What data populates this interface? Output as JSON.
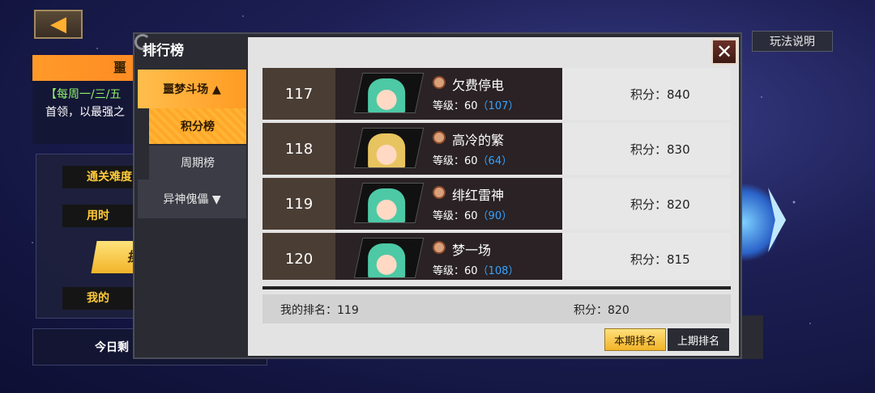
{
  "header": {
    "back_icon": "back-arrow-icon",
    "rules_label": "玩法说明"
  },
  "background": {
    "header_label": "噩",
    "desc_line1": "【每周一/三/五",
    "desc_line2": "首领，以最强之",
    "label_difficulty": "通关难度",
    "label_time": "用时",
    "label_mine": "我的",
    "button_short": "挑",
    "today_remaining": "今日剩"
  },
  "modal": {
    "title": "排行榜",
    "close_icon": "close-x-icon",
    "sidebar": {
      "main_active": "噩梦斗场 ▲",
      "sub_active": "积分榜",
      "sub_inactive": "周期榜",
      "main_inactive": "异神傀儡 ▼"
    },
    "rows": [
      {
        "rank": "117",
        "name": "欠费停电",
        "level_text": "等级：60",
        "level_paren": "（107）",
        "score": "积分：840",
        "avatar": "green"
      },
      {
        "rank": "118",
        "name": "高冷的繁",
        "level_text": "等级：60",
        "level_paren": "（64）",
        "score": "积分：830",
        "avatar": "blond"
      },
      {
        "rank": "119",
        "name": "绯红雷神",
        "level_text": "等级：60",
        "level_paren": "（90）",
        "score": "积分：820",
        "avatar": "green"
      },
      {
        "rank": "120",
        "name": "梦一场",
        "level_text": "等级：60",
        "level_paren": "（108）",
        "score": "积分：815",
        "avatar": "green"
      }
    ],
    "my_rank": "我的排名：119",
    "my_score": "积分：820",
    "tab_current": "本期排名",
    "tab_previous": "上期排名"
  },
  "colors": {
    "accent_orange": "#ff9b23",
    "level_blue": "#37a3ff",
    "row_dark": "#2a2224",
    "rank_box": "#4a3d34"
  }
}
